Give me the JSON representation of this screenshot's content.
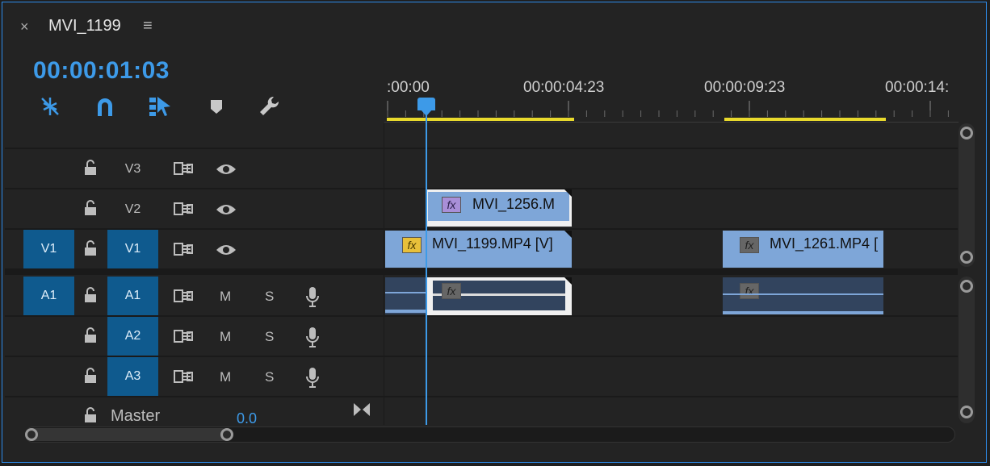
{
  "tab": {
    "close": "×",
    "title": "MVI_1199",
    "menu": "≡"
  },
  "timecode": "00:00:01:03",
  "tools": [
    "ripple-edit-icon",
    "snap-magnet-icon",
    "linked-selection-icon",
    "add-marker-icon",
    "wrench-settings-icon"
  ],
  "ruler": {
    "labels": [
      ":00:00",
      "00:00:04:23",
      "00:00:09:23",
      "00:00:14:"
    ]
  },
  "video_tracks": [
    {
      "source": "",
      "target": "V3",
      "clip": ""
    },
    {
      "source": "",
      "target": "V2",
      "clip": "MVI_1256.M"
    },
    {
      "source": "V1",
      "target": "V1",
      "clips": [
        "MVI_1199.MP4 [V]",
        "MVI_1261.MP4 ["
      ]
    }
  ],
  "audio_tracks": [
    {
      "source": "A1",
      "target": "A1",
      "mute": "M",
      "solo": "S"
    },
    {
      "source": "",
      "target": "A2",
      "mute": "M",
      "solo": "S"
    },
    {
      "source": "",
      "target": "A3",
      "mute": "M",
      "solo": "S"
    }
  ],
  "master": {
    "label": "Master",
    "value": "0.0"
  },
  "fx_label": "fx",
  "colors": {
    "accent": "#3d9ae8",
    "work_area": "#e8d92c",
    "clip_video": "#7ea6d8",
    "track_target": "#0f5a8e"
  }
}
